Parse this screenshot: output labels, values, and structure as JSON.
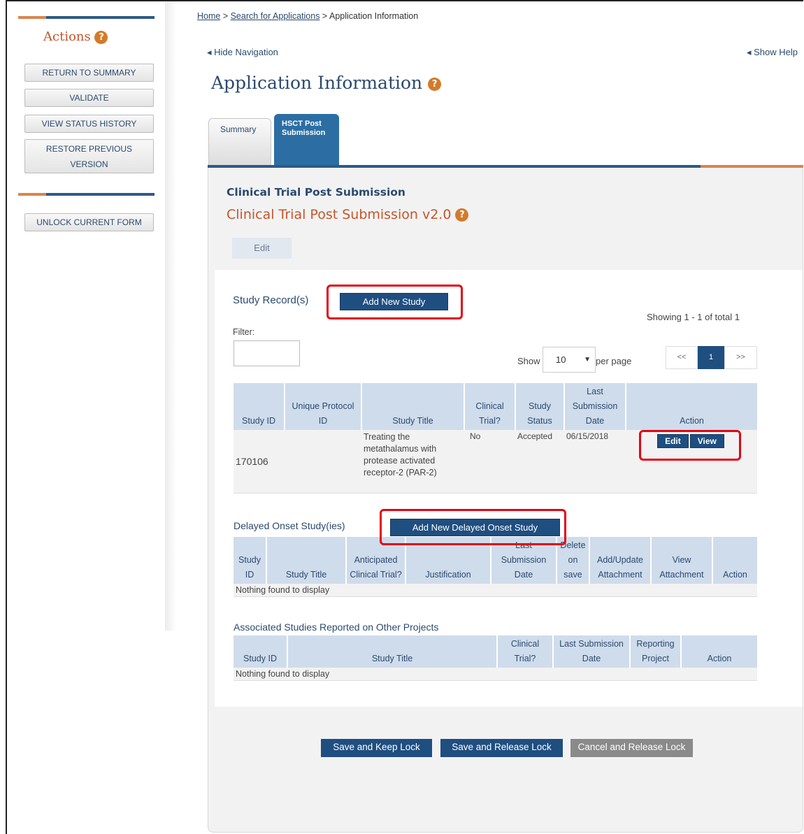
{
  "breadcrumb": {
    "home": "Home",
    "sep1": " > ",
    "search": "Search for Applications",
    "sep2": " > ",
    "current": "Application Information"
  },
  "nav": {
    "hide": "◂ Hide Navigation",
    "show_help": "◂ Show Help"
  },
  "page": {
    "title": "Application Information"
  },
  "sidebar": {
    "title": "Actions",
    "buttons": {
      "return_summary": "RETURN TO SUMMARY",
      "validate": "VALIDATE",
      "view_status": "VIEW STATUS HISTORY",
      "restore_line1": "RESTORE PREVIOUS",
      "restore_line2": "VERSION",
      "unlock": "UNLOCK CURRENT FORM"
    }
  },
  "tabs": {
    "summary": "Summary",
    "hsct_line1": "HSCT Post",
    "hsct_line2": "Submission"
  },
  "form": {
    "title": "Clinical Trial Post Submission",
    "version": "Clinical Trial Post Submission v2.0",
    "edit": "Edit"
  },
  "study_records": {
    "label": "Study Record(s)",
    "add_button": "Add New Study",
    "showing": "Showing 1 - 1 of total 1",
    "filter_label": "Filter:",
    "show_label": "Show",
    "per_page_value": "10",
    "per_page_label": "per page",
    "pager": {
      "prev": "<<",
      "page": "1",
      "next": ">>"
    },
    "headers": [
      "Study ID",
      "Unique Protocol ID",
      "Study Title",
      "Clinical Trial?",
      "Study Status",
      "Last Submission Date",
      "Action"
    ],
    "rows": [
      {
        "study_id": "170106",
        "protocol_id": "",
        "title": "Treating the metathalamus with protease activated receptor-2 (PAR-2)",
        "clinical": "No",
        "status": "Accepted",
        "date": "06/15/2018",
        "edit": "Edit",
        "view": "View"
      }
    ]
  },
  "delayed": {
    "label": "Delayed Onset Study(ies)",
    "add_button": "Add New Delayed Onset Study",
    "headers": [
      "Study ID",
      "Study Title",
      "Anticipated Clinical Trial?",
      "Justification",
      "Last Submission Date",
      "Delete on save",
      "Add/Update Attachment",
      "View Attachment",
      "Action"
    ],
    "empty": "Nothing found to display"
  },
  "associated": {
    "label": "Associated Studies Reported on Other Projects",
    "headers": [
      "Study ID",
      "Study Title",
      "Clinical Trial?",
      "Last Submission Date",
      "Reporting Project",
      "Action"
    ],
    "empty": "Nothing found to display"
  },
  "bottom": {
    "save_keep": "Save and Keep Lock",
    "save_release": "Save and Release Lock",
    "cancel_release": "Cancel and Release Lock"
  },
  "colors": {
    "primary": "#1f4e80",
    "accent": "#d9864a",
    "highlight": "#e30613"
  }
}
